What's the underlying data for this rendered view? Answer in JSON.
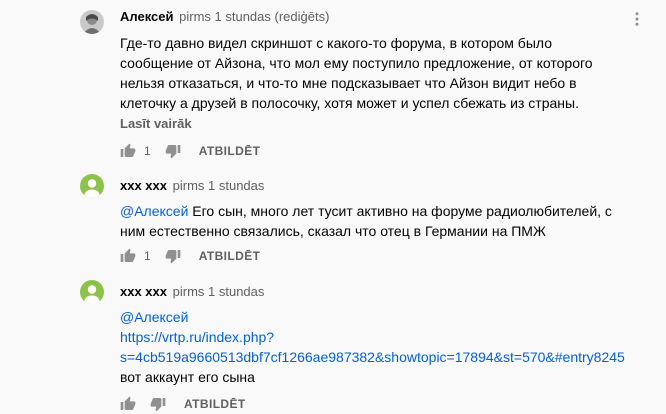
{
  "comments": [
    {
      "author": "Алексей",
      "time": "pirms 1 stundas (rediģēts)",
      "lines": [
        "Где-то давно видел скриншот с какого-то форума, в котором было",
        "сообщение от Айзона, что мол ему поступило предложение, от которого",
        "нельзя отказаться, и что-то мне подсказывает что Айзон видит небо в",
        "клеточку а друзей в полосочку, хотя может и успел сбежать из страны."
      ],
      "read_more": "Lasīt vairāk",
      "likes": "1",
      "reply_label": "ATBILDĒT"
    },
    {
      "author": "xxx xxx",
      "time": "pirms 1 stundas",
      "mention": "@Алексей",
      "line1_rest": "Его сын, много лет тусит активно на форуме радиолюбителей, с",
      "line2": "ним естественно связались, сказал что отец в Германии на ПМЖ",
      "likes": "1",
      "reply_label": "ATBILDĒT"
    },
    {
      "author": "xxx xxx",
      "time": "pirms 1 stundas",
      "mention": "@Алексей",
      "link_line1": "https://vrtp.ru/index.php?",
      "link_line2": "s=4cb519a9660513dbf7cf1266ae987382&showtopic=17894&st=570&#entry8245",
      "text_line": "вот аккаунт его сына",
      "reply_label": "ATBILDĒT"
    }
  ],
  "colors": {
    "avatar_green": "#8bc34a",
    "link": "#065fd4",
    "meta": "#606060"
  },
  "icons": {
    "like": "thumb-up-icon",
    "dislike": "thumb-down-icon",
    "menu": "more-vert-icon"
  }
}
